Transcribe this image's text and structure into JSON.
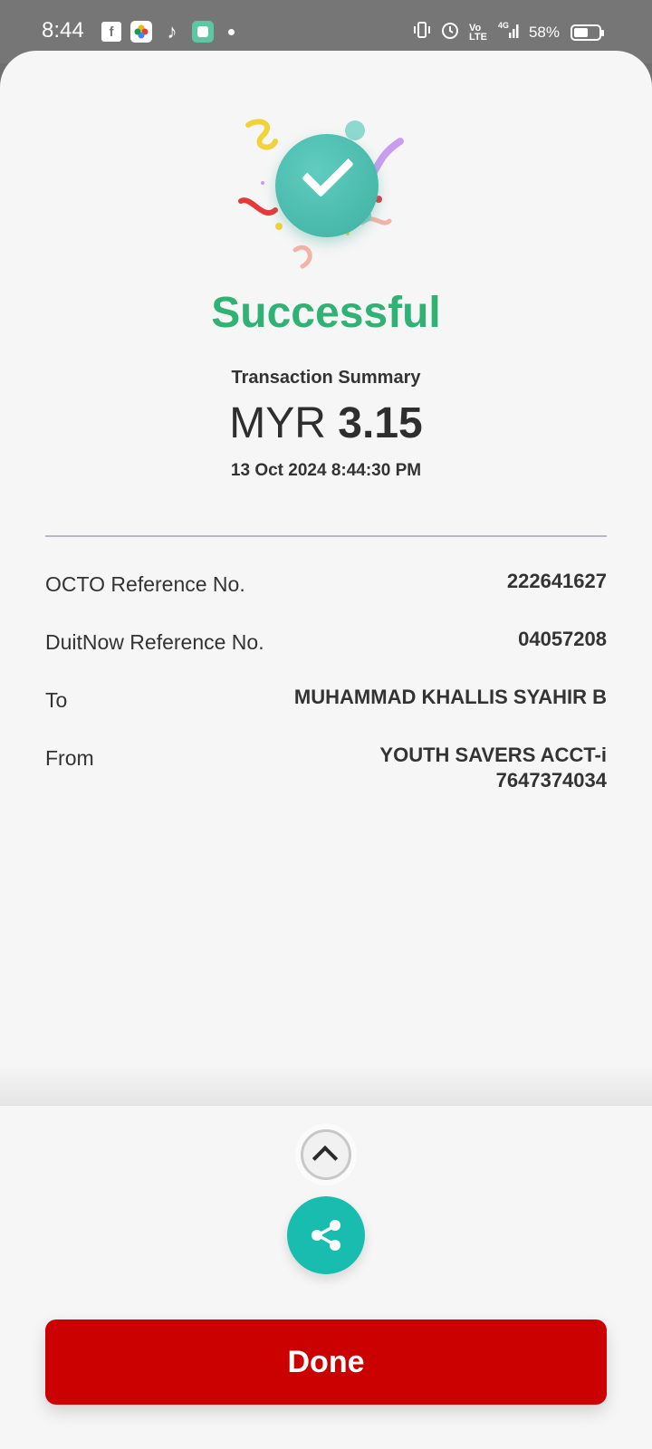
{
  "status_bar": {
    "time": "8:44",
    "battery_percent": "58%",
    "battery_level": 0.58,
    "icons": [
      "facebook-icon",
      "photos-icon",
      "tiktok-icon",
      "app-icon",
      "vibrate-icon",
      "alarm-icon",
      "volte-icon",
      "signal-4g-icon",
      "battery-icon"
    ]
  },
  "result": {
    "status": "Successful",
    "summary_label": "Transaction Summary",
    "currency": "MYR",
    "amount": "3.15",
    "datetime": "13 Oct 2024 8:44:30 PM"
  },
  "details": [
    {
      "label": "OCTO Reference No.",
      "value": "222641627"
    },
    {
      "label": "DuitNow Reference No.",
      "value": "04057208"
    },
    {
      "label": "To",
      "value": "MUHAMMAD KHALLIS SYAHIR B"
    },
    {
      "label": "From",
      "value": "YOUTH SAVERS ACCT-i",
      "value2": "7647374034"
    }
  ],
  "actions": {
    "done_label": "Done",
    "expand_icon": "chevron-up-icon",
    "share_icon": "share-icon"
  },
  "colors": {
    "success_green": "#2fb274",
    "teal": "#19bdb0",
    "done_red": "#cb0000"
  }
}
